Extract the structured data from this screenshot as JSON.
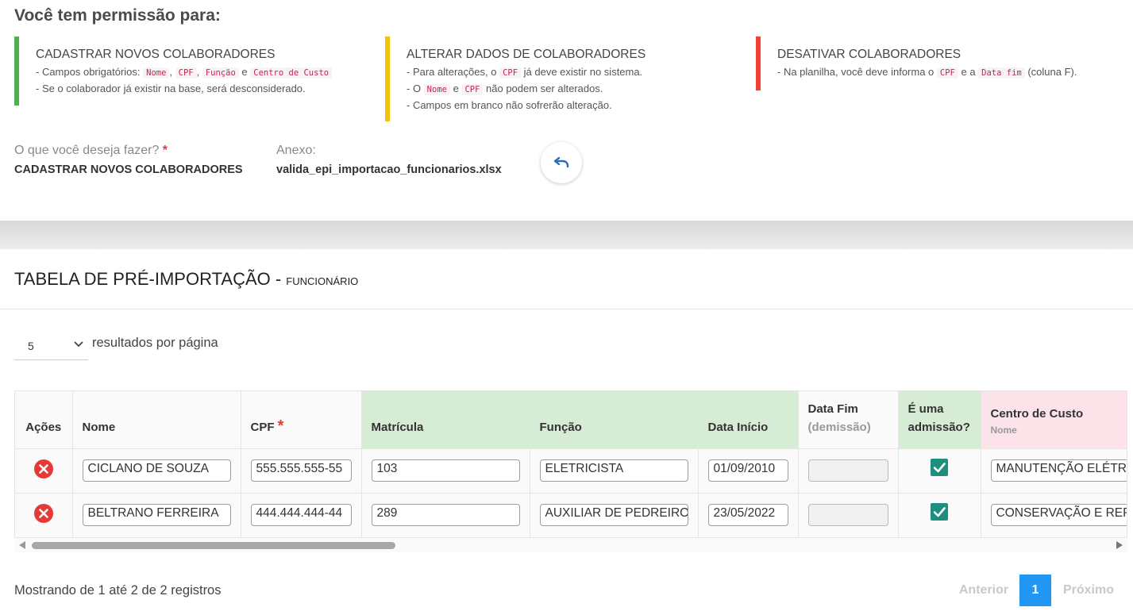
{
  "permissions": {
    "title": "Você tem permissão para:",
    "create": {
      "title": "CADASTRAR NOVOS COLABORADORES",
      "line1_prefix": "- Campos obrigatórios: ",
      "code_nome": "Nome",
      "sep1": ", ",
      "code_cpf": "CPF",
      "sep2": ", ",
      "code_funcao": "Função",
      "sep3": " e ",
      "code_centro": "Centro de Custo",
      "line2": "- Se o colaborador já existir na base, será desconsiderado."
    },
    "update": {
      "title": "ALTERAR DADOS DE COLABORADORES",
      "line1_prefix": "- Para alterações, o ",
      "code_cpf": "CPF",
      "line1_suffix": " já deve existir no sistema.",
      "line2_prefix": "- O ",
      "code_nome": "Nome",
      "line2_mid": " e ",
      "code_cpf2": "CPF",
      "line2_suffix": " não podem ser alterados.",
      "line3": "- Campos em branco não sofrerão alteração."
    },
    "deactivate": {
      "title": "DESATIVAR COLABORADORES",
      "line1_prefix": "- Na planilha, você deve informa o ",
      "code_cpf": "CPF",
      "line1_mid": " e a ",
      "code_datafim": "Data fim",
      "line1_suffix": " (coluna F)."
    },
    "colors": {
      "create": "#4caf50",
      "update": "#f4c20d",
      "deactivate": "#ef4136"
    }
  },
  "form": {
    "action_label": "O que você deseja fazer?",
    "action_required": "*",
    "action_value": "CADASTRAR NOVOS COLABORADORES",
    "attachment_label": "Anexo:",
    "attachment_value": "valida_epi_importacao_funcionarios.xlsx",
    "undo_icon": "undo-icon"
  },
  "table_section": {
    "title": "TABELA DE PRÉ-IMPORTAÇÃO - ",
    "subtitle": "FUNCIONÁRIO",
    "page_size": "5",
    "page_size_label": "resultados por página",
    "columns": {
      "acoes": "Ações",
      "nome": "Nome",
      "cpf": "CPF",
      "cpf_required": "*",
      "matricula": "Matrícula",
      "funcao": "Função",
      "data_inicio": "Data Início",
      "data_fim": "Data Fim",
      "data_fim_sub": "(demissão)",
      "admissao_line1": "É uma",
      "admissao_line2": "admissão?",
      "centro": "Centro de Custo",
      "centro_sub": "Nome"
    },
    "rows": [
      {
        "nome": "CICLANO DE SOUZA",
        "cpf": "555.555.555-55",
        "matricula": "103",
        "funcao": "ELETRICISTA",
        "data_inicio": "01/09/2010",
        "data_fim": "",
        "admissao": true,
        "centro": "MANUTENÇÃO ELÉTRI"
      },
      {
        "nome": "BELTRANO FERREIRA",
        "cpf": "444.444.444-44",
        "matricula": "289",
        "funcao": "AUXILIAR DE PEDREIRO",
        "data_inicio": "23/05/2022",
        "data_fim": "",
        "admissao": true,
        "centro": "CONSERVAÇÃO E REPA"
      }
    ],
    "showing": "Mostrando de 1 até 2 de 2 registros",
    "pager": {
      "prev": "Anterior",
      "page": "1",
      "next": "Próximo"
    }
  }
}
